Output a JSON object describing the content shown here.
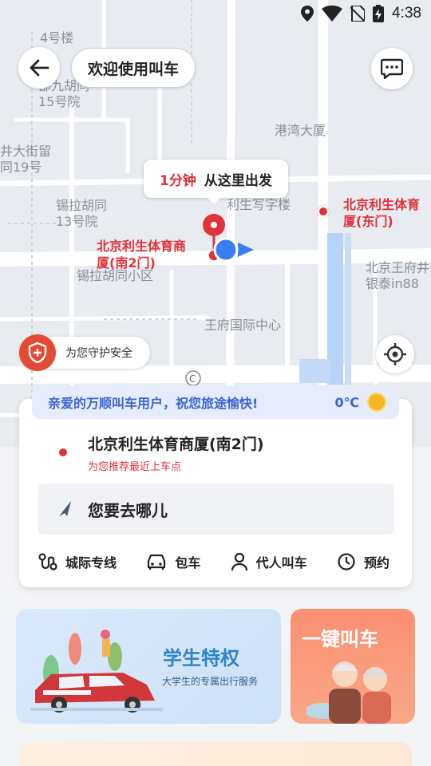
{
  "status_bar": {
    "time": "4:38",
    "icons": [
      "location-icon",
      "wifi-icon",
      "no-sim-icon",
      "battery-charging-icon"
    ]
  },
  "header": {
    "title": "欢迎使用叫车"
  },
  "map": {
    "labels": [
      "4号楼",
      "部九胡同\n15号院",
      "港湾大厦",
      "井大街留\n同19号",
      "锡拉胡同\n13号院",
      "利生写字楼",
      "锡拉胡同小区",
      "北京王府井\n银泰in88",
      "王府国际中心"
    ],
    "poi": {
      "east_gate": "北京利生体育\n厦(东门)",
      "south_gate": "北京利生体育商\n厦(南2门)"
    }
  },
  "pickup_bubble": {
    "time": "1分钟",
    "text": "从这里出发"
  },
  "safety": {
    "label": "为您守护安全"
  },
  "greeting": {
    "text": "亲爱的万顺叫车用户，祝您旅途愉快!",
    "temperature": "0℃"
  },
  "pickup": {
    "name": "北京利生体育商厦(南2门)",
    "hint": "为您推荐最近上车点"
  },
  "destination": {
    "placeholder": "您要去哪儿"
  },
  "services": [
    {
      "label": "城际专线",
      "icon": "intercity-route-icon"
    },
    {
      "label": "包车",
      "icon": "charter-car-icon"
    },
    {
      "label": "代人叫车",
      "icon": "person-icon"
    },
    {
      "label": "预约",
      "icon": "clock-icon"
    }
  ],
  "promos": {
    "student": {
      "title": "学生特权",
      "subtitle": "大学生的专属出行服务"
    },
    "one_key": {
      "title": "一键叫车"
    }
  },
  "colors": {
    "accent_red": "#e0323a",
    "accent_blue": "#3c63d6",
    "promo_orange": "#fb8f72"
  }
}
